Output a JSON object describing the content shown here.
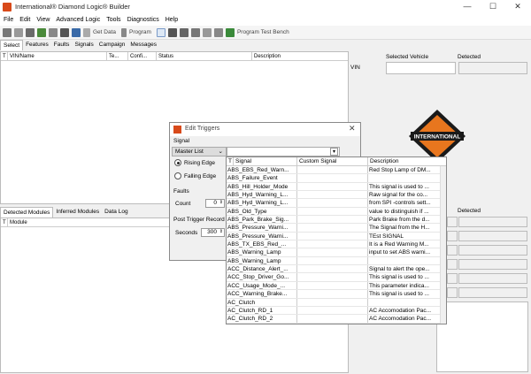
{
  "window": {
    "title": "International® Diamond Logic® Builder",
    "min": "—",
    "max": "☐",
    "close": "✕"
  },
  "menu": [
    "File",
    "Edit",
    "View",
    "Advanced Logic",
    "Tools",
    "Diagnostics",
    "Help"
  ],
  "toolbar": {
    "get_data": "Get Data",
    "program": "Program",
    "test_bench": "Program Test Bench"
  },
  "tabs": [
    "Select",
    "Features",
    "Faults",
    "Signals",
    "Campaign",
    "Messages"
  ],
  "vehicle_grid": {
    "headers": [
      "T",
      "VIN/Name",
      "Te...",
      "Confi...",
      "Status",
      "Description"
    ]
  },
  "right_panel": {
    "selected_vehicle": "Selected Vehicle",
    "detected": "Detected",
    "vin": "VIN",
    "detected2": "Detected"
  },
  "bottom_tabs": [
    "Detected Modules",
    "Inferred Modules",
    "Data Log"
  ],
  "module_grid": {
    "headers": [
      "T",
      "Module"
    ]
  },
  "dialog": {
    "title": "Edit Triggers",
    "signal_label": "Signal",
    "master_list": "Master List",
    "rising": "Rising Edge",
    "falling": "Falling Edge",
    "faults": "Faults",
    "count_label": "Count",
    "count_value": "0",
    "post_trigger": "Post Trigger Record",
    "seconds_label": "Seconds",
    "seconds_value": "300"
  },
  "dropdown": {
    "headers": [
      "T",
      "Signal",
      "Custom Signal",
      "Description"
    ],
    "rows": [
      [
        "ABS_EBS_Red_Warn...",
        "",
        "Red Stop Lamp of DM..."
      ],
      [
        "ABS_Failure_Event",
        "",
        ""
      ],
      [
        "ABS_Hill_Holder_Mode",
        "",
        "This signal is used to ..."
      ],
      [
        "ABS_Hyd_Warning_L...",
        "",
        "Raw signal for the co..."
      ],
      [
        "ABS_Hyd_Warning_L...",
        "",
        "from SPI -controls sett..."
      ],
      [
        "ABS_Old_Type",
        "",
        "value to distinguish if ..."
      ],
      [
        "ABS_Park_Brake_Sig...",
        "",
        "Park Brake from the d..."
      ],
      [
        "ABS_Pressure_Warni...",
        "",
        "The Signal from the H..."
      ],
      [
        "ABS_Pressure_Warni...",
        "",
        "TEst SIGNAL"
      ],
      [
        "ABS_TX_EBS_Red_...",
        "",
        "It is a Red Warning M..."
      ],
      [
        "ABS_Warning_Lamp",
        "",
        "input to set ABS warni..."
      ],
      [
        "ABS_Warning_Lamp",
        "",
        ""
      ],
      [
        "ACC_Distance_Alert_...",
        "",
        "Signal to alert the ope..."
      ],
      [
        "ACC_Stop_Driver_Go...",
        "",
        "This signal is used to ..."
      ],
      [
        "ACC_Usage_Mode_...",
        "",
        "This parameter indica..."
      ],
      [
        "ACC_Warning_Brake...",
        "",
        "This signal is used to ..."
      ],
      [
        "AC_Clutch",
        "",
        ""
      ],
      [
        "AC_Clutch_RD_1",
        "",
        "AC Accomodation Pac..."
      ],
      [
        "AC_Clutch_RD_2",
        "",
        "AC Accomodation Pac..."
      ]
    ]
  },
  "colors": {
    "accent": "#d84a1a",
    "selection": "#cce4f7"
  }
}
